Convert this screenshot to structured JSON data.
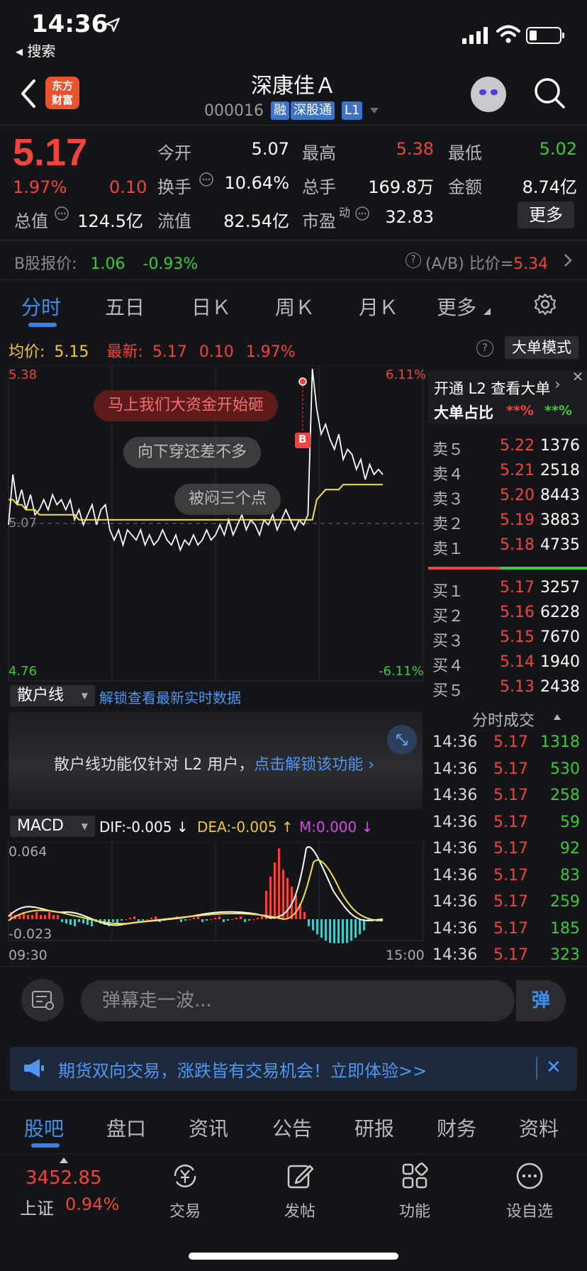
{
  "status_bar": {
    "time": "14:36",
    "back_label": "◂ 搜索"
  },
  "header": {
    "logo_line1": "东方",
    "logo_line2": "财富",
    "stock_name": "深康佳Ａ",
    "stock_code": "000016",
    "tags": [
      "融",
      "深股通",
      "L1"
    ]
  },
  "quote": {
    "price": "5.17",
    "change_pct": "1.97%",
    "change": "0.10",
    "open_label": "今开",
    "open": "5.07",
    "high_label": "最高",
    "high": "5.38",
    "low_label": "最低",
    "low": "5.02",
    "turnover_label": "换手",
    "turnover": "10.64%",
    "volume_label": "总手",
    "volume": "169.8万",
    "amount_label": "金额",
    "amount": "8.74亿",
    "mktcap_label": "总值",
    "mktcap": "124.5亿",
    "float_label": "流值",
    "float": "82.54亿",
    "pe_label": "市盈",
    "pe_sup": "动",
    "pe": "32.83",
    "more_label": "更多"
  },
  "bshare": {
    "label": "B股报价:",
    "price": "1.06",
    "change": "-0.93%",
    "ratio_label": "(A/B) 比价=",
    "ratio": "5.34"
  },
  "tabs": [
    "分时",
    "五日",
    "日Ｋ",
    "周Ｋ",
    "月Ｋ",
    "更多"
  ],
  "avg": {
    "avg_label": "均价:",
    "avg": "5.15",
    "latest_label": "最新:",
    "latest": "5.17",
    "chg": "0.10",
    "pct": "1.97%",
    "mode_label": "大单模式"
  },
  "chart": {
    "y_top": "5.38",
    "y_mid": "5.07",
    "y_bot": "4.76",
    "pct_top": "6.11%",
    "pct_bot": "-6.11%",
    "bubbles": [
      "马上我们大资金开始砸",
      "向下穿还差不多",
      "被闷三个点"
    ],
    "marker": "B"
  },
  "chart_data": {
    "type": "line",
    "title": "",
    "ylim": [
      4.76,
      5.38
    ],
    "reference": 5.07,
    "series": [
      {
        "name": "",
        "values": [
          5.07,
          5.17,
          5.11,
          5.14,
          5.1,
          5.13,
          5.09,
          5.1,
          5.12,
          5.1,
          5.13,
          5.11,
          5.12,
          5.1,
          5.12,
          5.08,
          5.1,
          5.07,
          5.09,
          5.11,
          5.07,
          5.1,
          5.11,
          5.06,
          5.04,
          5.06,
          5.03,
          5.06,
          5.05,
          5.04,
          5.06,
          5.03,
          5.05,
          5.03,
          5.04,
          5.06,
          5.04,
          5.03,
          5.05,
          5.02,
          5.04,
          5.03,
          5.05,
          5.03,
          5.04,
          5.06,
          5.04,
          5.05,
          5.07,
          5.05,
          5.08,
          5.05,
          5.07,
          5.09,
          5.06,
          5.08,
          5.07,
          5.05,
          5.08,
          5.07,
          5.09,
          5.06,
          5.08,
          5.1,
          5.08,
          5.06,
          5.08,
          5.07,
          5.09,
          5.38,
          5.3,
          5.25,
          5.27,
          5.24,
          5.22,
          5.25,
          5.2,
          5.22,
          5.21,
          5.18,
          5.2,
          5.16,
          5.19,
          5.17,
          5.18,
          5.17
        ]
      },
      {
        "name": "",
        "values": [
          5.12,
          5.12,
          5.11,
          5.11,
          5.1,
          5.1,
          5.1,
          5.09,
          5.09,
          5.09,
          5.09,
          5.09,
          5.09,
          5.09,
          5.09,
          5.09,
          5.08,
          5.08,
          5.08,
          5.08,
          5.08,
          5.08,
          5.08,
          5.08,
          5.08,
          5.08,
          5.08,
          5.08,
          5.08,
          5.08,
          5.08,
          5.08,
          5.08,
          5.08,
          5.08,
          5.08,
          5.08,
          5.08,
          5.08,
          5.08,
          5.08,
          5.08,
          5.08,
          5.08,
          5.08,
          5.08,
          5.08,
          5.08,
          5.08,
          5.08,
          5.08,
          5.08,
          5.08,
          5.08,
          5.08,
          5.08,
          5.08,
          5.08,
          5.08,
          5.08,
          5.08,
          5.08,
          5.08,
          5.08,
          5.08,
          5.08,
          5.08,
          5.08,
          5.08,
          5.08,
          5.12,
          5.13,
          5.14,
          5.14,
          5.14,
          5.14,
          5.15,
          5.15,
          5.15,
          5.15,
          5.15,
          5.15,
          5.15,
          5.15,
          5.15,
          5.15
        ]
      }
    ]
  },
  "orderbook": {
    "promo_line": "开通 L2 查看大单",
    "ratio_label": "大单占比",
    "ratio_red": "**%",
    "ratio_green": "**%",
    "sells": [
      {
        "label": "卖５",
        "price": "5.22",
        "vol": "1376"
      },
      {
        "label": "卖４",
        "price": "5.21",
        "vol": "2518"
      },
      {
        "label": "卖３",
        "price": "5.20",
        "vol": "8443"
      },
      {
        "label": "卖２",
        "price": "5.19",
        "vol": "3883"
      },
      {
        "label": "卖１",
        "price": "5.18",
        "vol": "4735"
      }
    ],
    "buys": [
      {
        "label": "买１",
        "price": "5.17",
        "vol": "3257"
      },
      {
        "label": "买２",
        "price": "5.16",
        "vol": "6228"
      },
      {
        "label": "买３",
        "price": "5.15",
        "vol": "7670"
      },
      {
        "label": "买４",
        "price": "5.14",
        "vol": "1940"
      },
      {
        "label": "买５",
        "price": "5.13",
        "vol": "2438"
      }
    ],
    "ticks_label": "分时成交",
    "ticks": [
      {
        "time": "14:36",
        "price": "5.17",
        "vol": "1318"
      },
      {
        "time": "14:36",
        "price": "5.17",
        "vol": "530"
      },
      {
        "time": "14:36",
        "price": "5.17",
        "vol": "258"
      },
      {
        "time": "14:36",
        "price": "5.17",
        "vol": "59"
      },
      {
        "time": "14:36",
        "price": "5.17",
        "vol": "92"
      },
      {
        "time": "14:36",
        "price": "5.17",
        "vol": "83"
      },
      {
        "time": "14:36",
        "price": "5.17",
        "vol": "259"
      },
      {
        "time": "14:36",
        "price": "5.17",
        "vol": "185"
      },
      {
        "time": "14:36",
        "price": "5.17",
        "vol": "323"
      }
    ]
  },
  "sanhu": {
    "select": "散户线",
    "unlock_link": "解锁查看最新实时数据",
    "message": "散户线功能仅针对 L2 用户，",
    "message_link": "点击解锁该功能 ›"
  },
  "macd": {
    "select": "MACD",
    "dif": "DIF:-0.005 ↓",
    "dea": "DEA:-0.005 ↑",
    "m": "M:0.000 ↓",
    "y_top": "0.064",
    "y_bot": "-0.023",
    "t_start": "09:30",
    "t_end": "15:00"
  },
  "danmu": {
    "placeholder": "弹幕走一波...",
    "send": "弹"
  },
  "ad": {
    "text": "期货双向交易，涨跌皆有交易机会！立即体验>>"
  },
  "bottom_tabs": [
    "股吧",
    "盘口",
    "资讯",
    "公告",
    "研报",
    "财务",
    "资料"
  ],
  "nav": {
    "index_value": "3452.85",
    "index_name": "上证",
    "index_pct": "0.94%",
    "items": [
      "交易",
      "发帖",
      "功能",
      "设自选"
    ]
  },
  "colors": {
    "up": "#f0443c",
    "down": "#3fc83a",
    "accent": "#3d7fe0",
    "avg_line": "#f2e14a"
  }
}
